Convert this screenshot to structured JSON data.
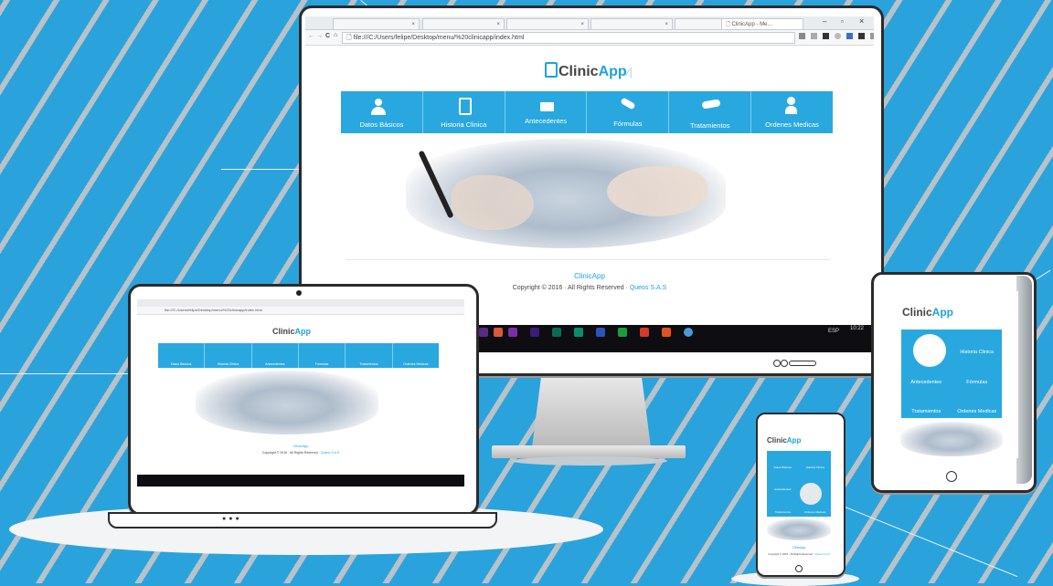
{
  "browser": {
    "tabs": [
      "×",
      "×",
      "×",
      "×",
      "×",
      "ClinicApp - Me…"
    ],
    "url": "file:///C:/Users/felipe/Desktop/menu/%20clinicapp/index.html",
    "window_controls": [
      "–",
      "▫",
      "×"
    ],
    "nav_arrows": [
      "←",
      "→"
    ],
    "reload": "C",
    "home": "⌂",
    "page_icon": "🗋"
  },
  "logo": {
    "prefix": "Clinic",
    "suffix": "App"
  },
  "menu": [
    {
      "label": "Datos Básicos",
      "icon": "person-icon"
    },
    {
      "label": "Historia Clinica",
      "icon": "clipboard-icon"
    },
    {
      "label": "Antecedentes",
      "icon": "folder-icon"
    },
    {
      "label": "Fórmulas",
      "icon": "pill-icon"
    },
    {
      "label": "Tratamientos",
      "icon": "treatment-icon"
    },
    {
      "label": "Ordenes Medicas",
      "icon": "doctor-icon"
    }
  ],
  "footer": {
    "title": "ClinicApp",
    "copyright": "Copyright © 2016 · All Rights Reserved ·",
    "company": "Queos S.A.S"
  },
  "taskbar": {
    "lang": "ESP",
    "time": "10:22"
  },
  "laptop": {
    "url": "file:///C:/Users/felipe/Desktop/menu/%20clinicapp/index.html"
  },
  "colors": {
    "accent": "#29a8e0",
    "background": "#2aa3dc",
    "stripe": "#b9c2c9"
  }
}
